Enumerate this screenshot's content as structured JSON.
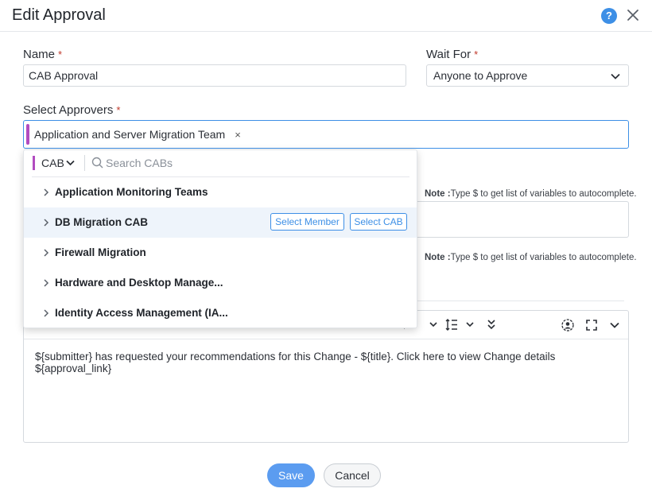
{
  "header": {
    "title": "Edit Approval",
    "help_label": "?"
  },
  "form": {
    "name_label": "Name",
    "name_value": "CAB Approval",
    "wait_label": "Wait For",
    "wait_value": "Anyone to Approve",
    "approvers_label": "Select Approvers",
    "required_mark": "*",
    "approver_chip": "Application and Server Migration Team",
    "chip_remove": "×"
  },
  "notes": [
    {
      "prefix": "Note :",
      "text": "Type $ to get list of variables to autocomplete."
    },
    {
      "prefix": "Note :",
      "text": "Type $ to get list of variables to autocomplete."
    }
  ],
  "dropdown": {
    "type": "CAB",
    "search_placeholder": "Search CABs",
    "items": [
      {
        "label": "Application Monitoring Teams"
      },
      {
        "label": "DB Migration CAB",
        "select_member": "Select Member",
        "select_cab": "Select CAB"
      },
      {
        "label": "Firewall Migration"
      },
      {
        "label": "Hardware and Desktop Manage..."
      },
      {
        "label": "Identity Access Management (IA..."
      }
    ]
  },
  "editor": {
    "body": "${submitter} has requested your recommendations for this Change - ${title}. Click here to view Change details ${approval_link}"
  },
  "footer": {
    "save_label": "Save",
    "cancel_label": "Cancel"
  },
  "colors": {
    "accent": "#3d8fe6",
    "chip_bar": "#b24cc0",
    "required": "#c0392b",
    "save_bg": "#5b9cf0"
  }
}
